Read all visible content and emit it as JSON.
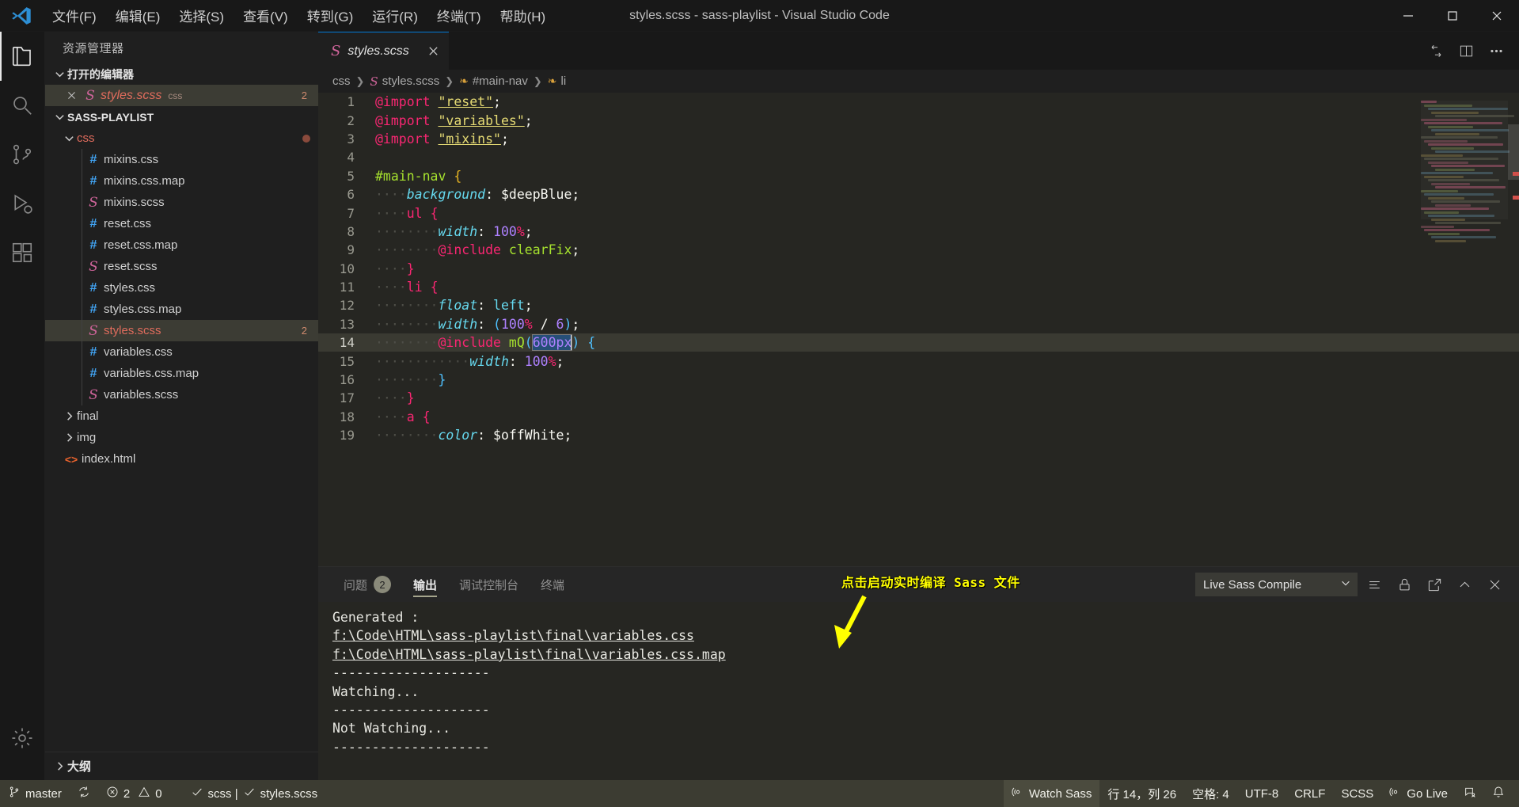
{
  "titlebar": {
    "logo_icon": "vscode-logo-icon",
    "title": "styles.scss - sass-playlist - Visual Studio Code",
    "menus": [
      {
        "label": "文件(F)",
        "name": "menu-file"
      },
      {
        "label": "编辑(E)",
        "name": "menu-edit"
      },
      {
        "label": "选择(S)",
        "name": "menu-selection"
      },
      {
        "label": "查看(V)",
        "name": "menu-view"
      },
      {
        "label": "转到(G)",
        "name": "menu-go"
      },
      {
        "label": "运行(R)",
        "name": "menu-run"
      },
      {
        "label": "终端(T)",
        "name": "menu-terminal"
      },
      {
        "label": "帮助(H)",
        "name": "menu-help"
      }
    ],
    "window_controls": [
      "minimize-icon",
      "maximize-icon",
      "close-icon"
    ]
  },
  "activitybar": {
    "items": [
      {
        "name": "explorer-icon",
        "active": true
      },
      {
        "name": "search-icon",
        "active": false
      },
      {
        "name": "source-control-icon",
        "active": false
      },
      {
        "name": "run-debug-icon",
        "active": false
      },
      {
        "name": "extensions-icon",
        "active": false
      }
    ],
    "bottom": [
      {
        "name": "settings-gear-icon"
      }
    ]
  },
  "sidebar": {
    "title": "资源管理器",
    "open_editors": {
      "label": "打开的编辑器",
      "expanded": true,
      "items": [
        {
          "name": "styles.scss",
          "type": "css",
          "badge": "2",
          "icon": "sass-file-icon",
          "selected": true
        }
      ]
    },
    "project": {
      "label": "SASS-PLAYLIST",
      "expanded": true,
      "folder": {
        "label": "css",
        "expanded": true,
        "dirty": true
      },
      "files": [
        {
          "name": "mixins.css",
          "icon": "css-file-icon",
          "badge": ""
        },
        {
          "name": "mixins.css.map",
          "icon": "css-file-icon",
          "badge": ""
        },
        {
          "name": "mixins.scss",
          "icon": "sass-file-icon",
          "badge": ""
        },
        {
          "name": "reset.css",
          "icon": "css-file-icon",
          "badge": ""
        },
        {
          "name": "reset.css.map",
          "icon": "css-file-icon",
          "badge": ""
        },
        {
          "name": "reset.scss",
          "icon": "sass-file-icon",
          "badge": ""
        },
        {
          "name": "styles.css",
          "icon": "css-file-icon",
          "badge": ""
        },
        {
          "name": "styles.css.map",
          "icon": "css-file-icon",
          "badge": ""
        },
        {
          "name": "styles.scss",
          "icon": "sass-file-icon",
          "badge": "2",
          "selected": true
        },
        {
          "name": "variables.css",
          "icon": "css-file-icon",
          "badge": ""
        },
        {
          "name": "variables.css.map",
          "icon": "css-file-icon",
          "badge": ""
        },
        {
          "name": "variables.scss",
          "icon": "sass-file-icon",
          "badge": ""
        }
      ],
      "folders": [
        {
          "name": "final",
          "expanded": false
        },
        {
          "name": "img",
          "expanded": false
        }
      ],
      "root_files": [
        {
          "name": "index.html",
          "icon": "html-file-icon"
        }
      ]
    },
    "outline_label": "大纲"
  },
  "editor": {
    "tab": {
      "label": "styles.scss",
      "icon": "sass-file-icon",
      "close_icon": "close-icon"
    },
    "tab_actions": [
      "split-compare-icon",
      "split-editor-icon",
      "more-actions-icon"
    ],
    "breadcrumbs": [
      {
        "text": "css",
        "icon": ""
      },
      {
        "text": "styles.scss",
        "icon": "sass-file-icon"
      },
      {
        "text": "#main-nav",
        "icon": "css-selector-icon"
      },
      {
        "text": "li",
        "icon": "css-selector-icon"
      }
    ],
    "cursor_line": 14,
    "selection_text": "600px",
    "lines": [
      {
        "n": 1,
        "indent": 0,
        "tokens": [
          [
            "at",
            "@import"
          ],
          [
            "sp",
            " "
          ],
          [
            "str",
            "\"reset\""
          ],
          [
            "punc",
            ";"
          ]
        ]
      },
      {
        "n": 2,
        "indent": 0,
        "tokens": [
          [
            "at",
            "@import"
          ],
          [
            "sp",
            " "
          ],
          [
            "str",
            "\"variables\""
          ],
          [
            "punc",
            ";"
          ]
        ]
      },
      {
        "n": 3,
        "indent": 0,
        "tokens": [
          [
            "at",
            "@import"
          ],
          [
            "sp",
            " "
          ],
          [
            "str",
            "\"mixins\""
          ],
          [
            "punc",
            ";"
          ]
        ]
      },
      {
        "n": 4,
        "indent": 0,
        "tokens": []
      },
      {
        "n": 5,
        "indent": 0,
        "tokens": [
          [
            "sel",
            "#main-nav"
          ],
          [
            "sp",
            " "
          ],
          [
            "b1",
            "{"
          ]
        ]
      },
      {
        "n": 6,
        "indent": 1,
        "tokens": [
          [
            "prop",
            "background"
          ],
          [
            "punc",
            ": "
          ],
          [
            "var",
            "$deepBlue"
          ],
          [
            "punc",
            ";"
          ]
        ]
      },
      {
        "n": 7,
        "indent": 1,
        "tokens": [
          [
            "sel2",
            "ul"
          ],
          [
            "sp",
            " "
          ],
          [
            "b2",
            "{"
          ]
        ]
      },
      {
        "n": 8,
        "indent": 2,
        "tokens": [
          [
            "prop",
            "width"
          ],
          [
            "punc",
            ": "
          ],
          [
            "num",
            "100"
          ],
          [
            "unit",
            "%"
          ],
          [
            "punc",
            ";"
          ]
        ]
      },
      {
        "n": 9,
        "indent": 2,
        "tokens": [
          [
            "at",
            "@include"
          ],
          [
            "sp",
            " "
          ],
          [
            "fn",
            "clearFix"
          ],
          [
            "punc",
            ";"
          ]
        ]
      },
      {
        "n": 10,
        "indent": 1,
        "tokens": [
          [
            "b2",
            "}"
          ]
        ]
      },
      {
        "n": 11,
        "indent": 1,
        "tokens": [
          [
            "sel2",
            "li"
          ],
          [
            "sp",
            " "
          ],
          [
            "b2",
            "{"
          ]
        ]
      },
      {
        "n": 12,
        "indent": 2,
        "tokens": [
          [
            "prop",
            "float"
          ],
          [
            "punc",
            ": "
          ],
          [
            "val",
            "left"
          ],
          [
            "punc",
            ";"
          ]
        ]
      },
      {
        "n": 13,
        "indent": 2,
        "tokens": [
          [
            "prop",
            "width"
          ],
          [
            "punc",
            ": "
          ],
          [
            "paren",
            "("
          ],
          [
            "num",
            "100"
          ],
          [
            "unit",
            "%"
          ],
          [
            "punc",
            " / "
          ],
          [
            "num",
            "6"
          ],
          [
            "paren",
            ")"
          ],
          [
            "punc",
            ";"
          ]
        ]
      },
      {
        "n": 14,
        "indent": 2,
        "tokens": [
          [
            "at",
            "@include"
          ],
          [
            "sp",
            " "
          ],
          [
            "fn",
            "mQ"
          ],
          [
            "paren",
            "("
          ],
          [
            "selhl",
            "600px"
          ],
          [
            "caret",
            ""
          ],
          [
            "paren",
            ")"
          ],
          [
            "sp",
            " "
          ],
          [
            "b3",
            "{"
          ]
        ],
        "current": true
      },
      {
        "n": 15,
        "indent": 3,
        "tokens": [
          [
            "prop",
            "width"
          ],
          [
            "punc",
            ": "
          ],
          [
            "num",
            "100"
          ],
          [
            "unit",
            "%"
          ],
          [
            "punc",
            ";"
          ]
        ]
      },
      {
        "n": 16,
        "indent": 2,
        "tokens": [
          [
            "b3",
            "}"
          ]
        ]
      },
      {
        "n": 17,
        "indent": 1,
        "tokens": [
          [
            "b2",
            "}"
          ]
        ]
      },
      {
        "n": 18,
        "indent": 1,
        "tokens": [
          [
            "sel2",
            "a"
          ],
          [
            "sp",
            " "
          ],
          [
            "b2",
            "{"
          ]
        ]
      },
      {
        "n": 19,
        "indent": 2,
        "tokens": [
          [
            "prop",
            "color"
          ],
          [
            "punc",
            ": "
          ],
          [
            "var",
            "$offWhite"
          ],
          [
            "punc",
            ";"
          ]
        ]
      }
    ]
  },
  "panel": {
    "tabs": [
      {
        "label": "问题",
        "badge": "2",
        "active": false,
        "name": "tab-problems"
      },
      {
        "label": "输出",
        "badge": "",
        "active": true,
        "name": "tab-output"
      },
      {
        "label": "调试控制台",
        "badge": "",
        "active": false,
        "name": "tab-debug-console"
      },
      {
        "label": "终端",
        "badge": "",
        "active": false,
        "name": "tab-terminal"
      }
    ],
    "channel_selected": "Live Sass Compile",
    "actions": [
      "clear-output-icon",
      "lock-icon",
      "open-editor-icon",
      "maximize-panel-icon",
      "close-panel-icon"
    ],
    "output_lines": [
      {
        "text": "Generated :",
        "link": false
      },
      {
        "text": "f:\\Code\\HTML\\sass-playlist\\final\\variables.css",
        "link": true
      },
      {
        "text": "f:\\Code\\HTML\\sass-playlist\\final\\variables.css.map",
        "link": true
      },
      {
        "text": "--------------------",
        "link": false
      },
      {
        "text": "Watching...",
        "link": false
      },
      {
        "text": "--------------------",
        "link": false
      },
      {
        "text": "Not Watching...",
        "link": false
      },
      {
        "text": "--------------------",
        "link": false
      }
    ]
  },
  "annotation": {
    "text": "点击启动实时编译 Sass 文件",
    "color": "#ffff00",
    "arrow_icon": "arrow-down-icon"
  },
  "statusbar": {
    "left": [
      {
        "label": "master",
        "icon": "source-control-branch-icon",
        "name": "status-branch"
      },
      {
        "label": "",
        "icon": "sync-icon",
        "name": "status-sync"
      },
      {
        "label": "2",
        "icon": "error-icon",
        "label2": "0",
        "icon2": "warning-icon",
        "name": "status-problems"
      },
      {
        "label": "scss | ",
        "icon": "check-icon",
        "label2": "styles.scss",
        "icon2": "check-icon",
        "name": "status-scss"
      }
    ],
    "right": [
      {
        "label": "Watch Sass",
        "icon": "broadcast-icon",
        "name": "status-watch-sass",
        "highlight": true
      },
      {
        "label": "行 14，列 26",
        "icon": "",
        "name": "status-cursor-position"
      },
      {
        "label": "空格: 4",
        "icon": "",
        "name": "status-indentation"
      },
      {
        "label": "UTF-8",
        "icon": "",
        "name": "status-encoding"
      },
      {
        "label": "CRLF",
        "icon": "",
        "name": "status-eol"
      },
      {
        "label": "SCSS",
        "icon": "",
        "name": "status-language-mode"
      },
      {
        "label": "Go Live",
        "icon": "broadcast-icon",
        "name": "status-go-live"
      },
      {
        "label": "",
        "icon": "feedback-icon",
        "name": "status-feedback"
      },
      {
        "label": "",
        "icon": "bell-icon",
        "name": "status-notifications"
      }
    ]
  },
  "colors": {
    "accent": "#0078d4",
    "sass_pink": "#cf649a",
    "keyword_pink": "#f92672",
    "string_yellow": "#e6db74",
    "green": "#a6e22e",
    "cyan": "#66d9ef",
    "purple": "#ae81ff",
    "annotation_yellow": "#ffff00",
    "statusbar_bg": "#3c3c32"
  }
}
